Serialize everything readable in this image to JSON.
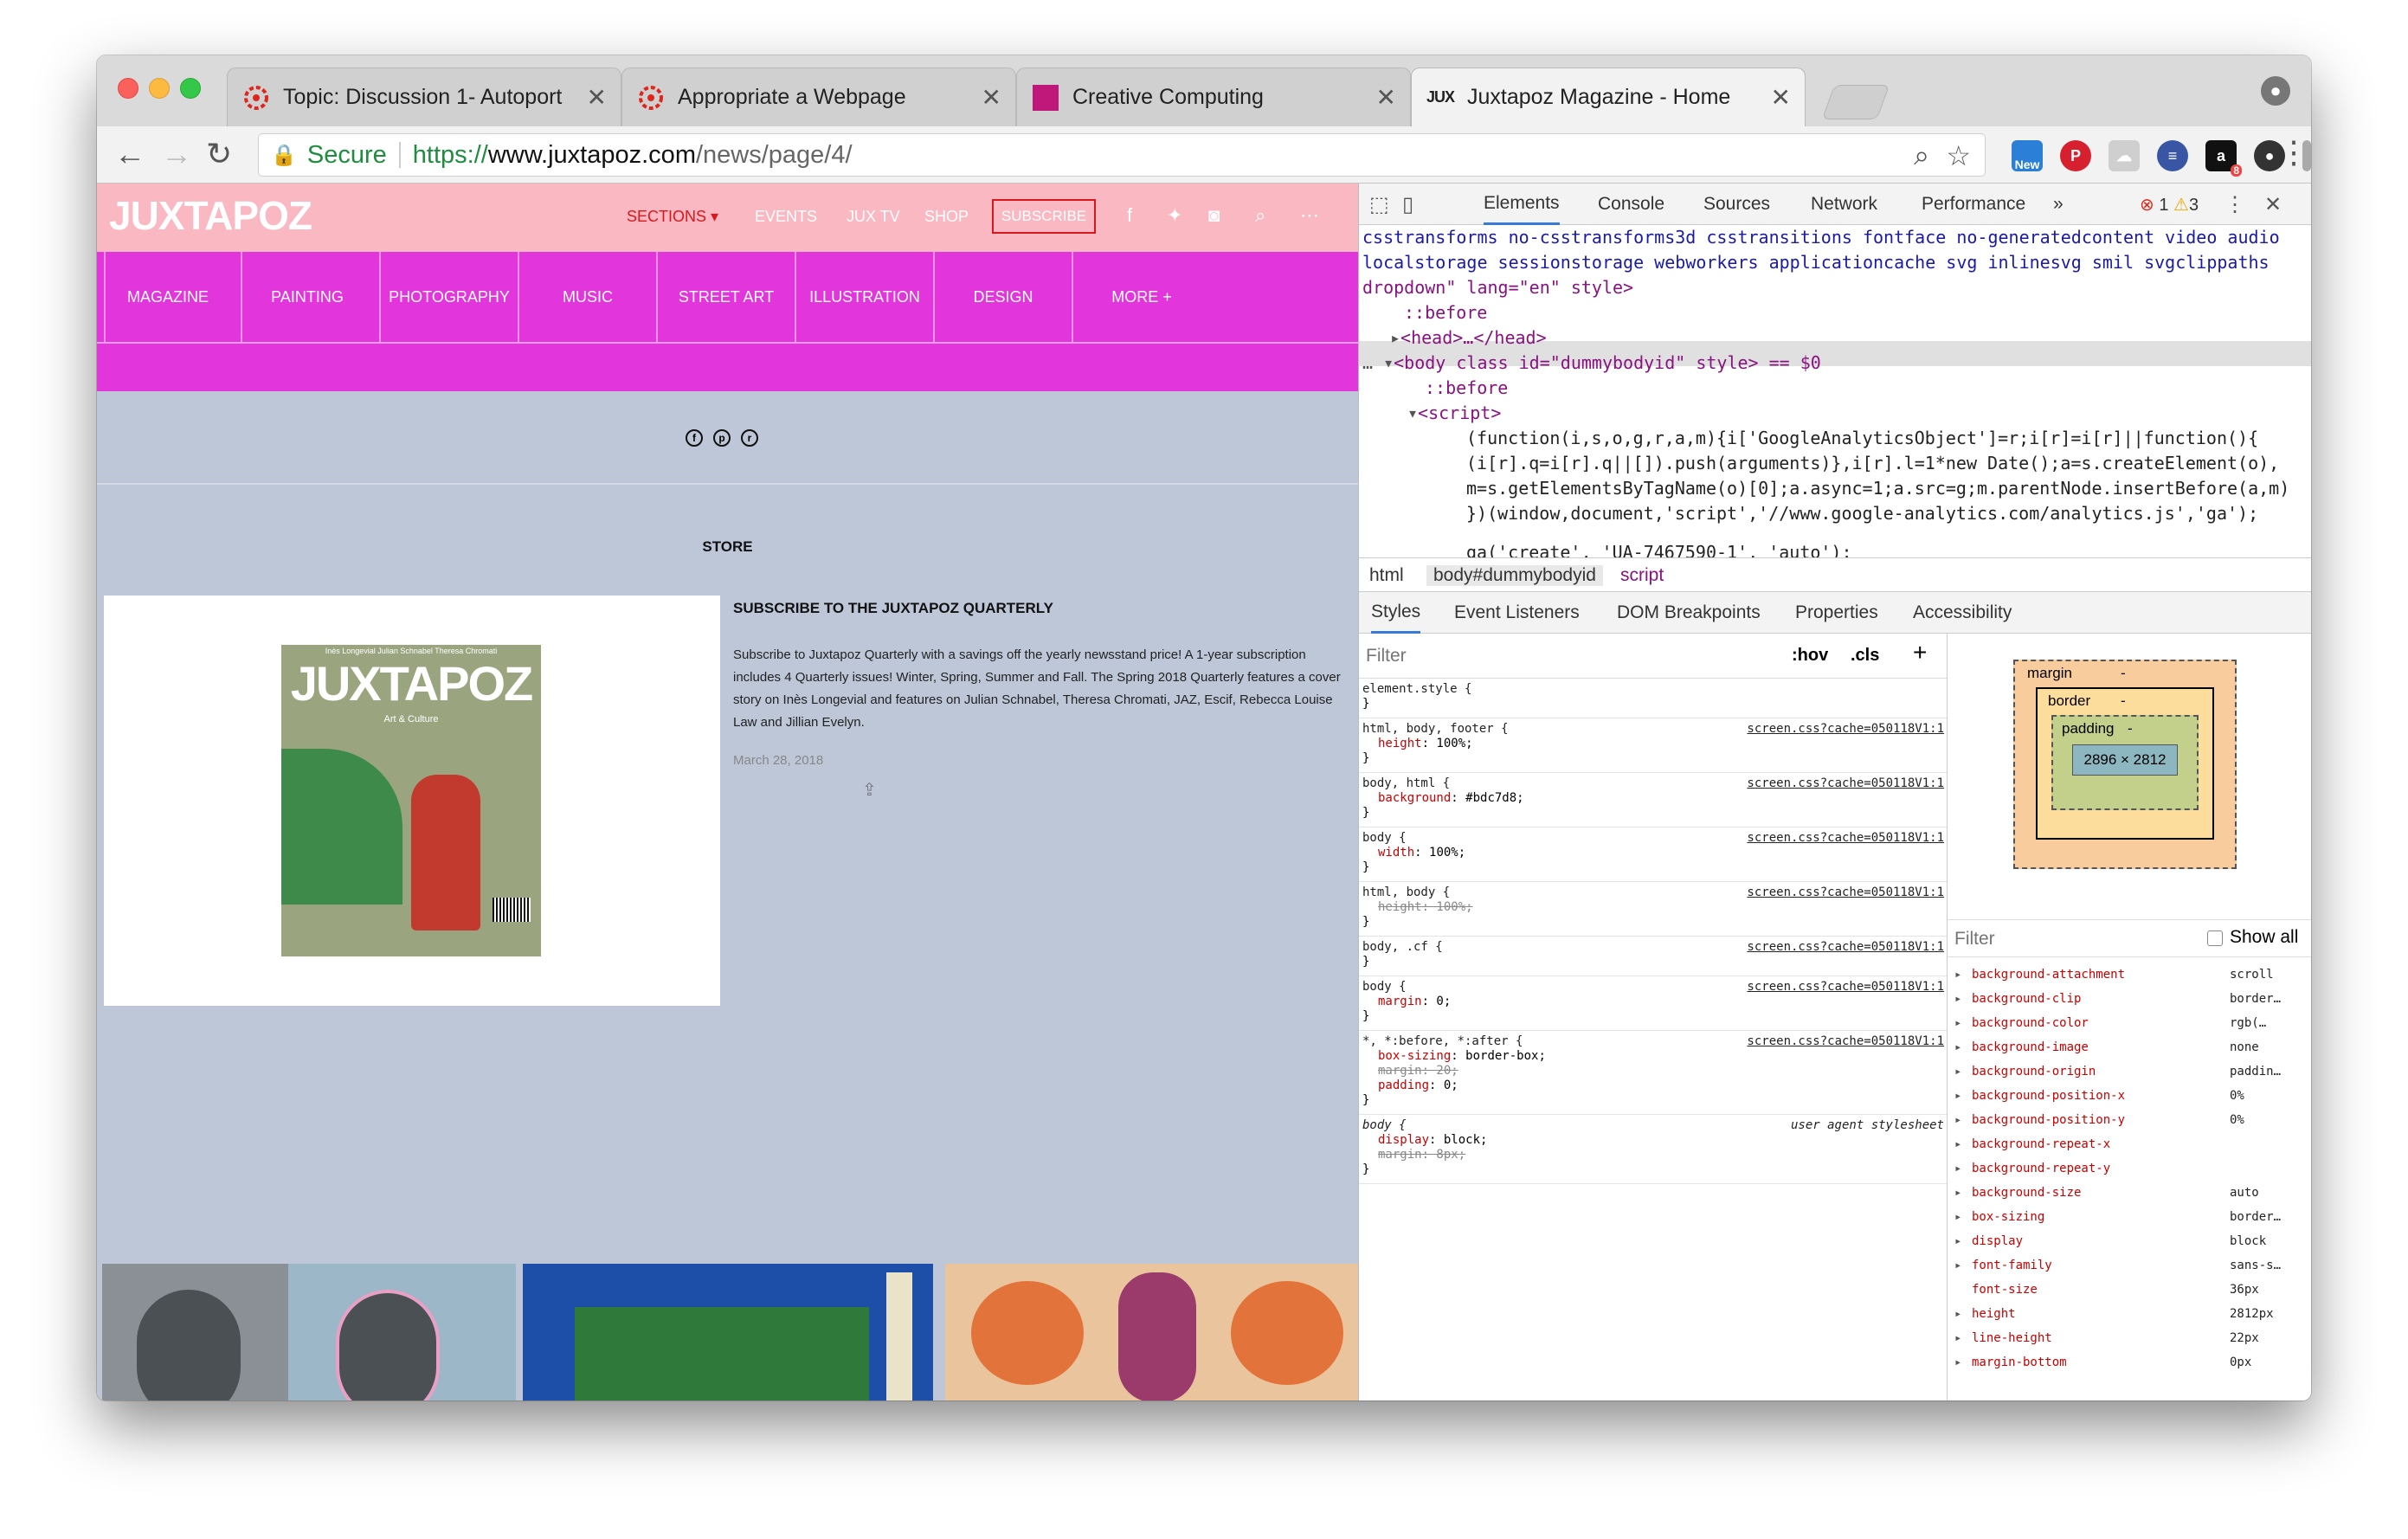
{
  "tabs": [
    {
      "title": "Topic: Discussion 1- Autoport",
      "close": "✕"
    },
    {
      "title": "Appropriate a Webpage",
      "close": "✕"
    },
    {
      "title": "Creative Computing",
      "close": "✕"
    },
    {
      "title": "Juxtapoz Magazine - Home",
      "close": "✕",
      "favicon_text": "JUX"
    }
  ],
  "toolbar": {
    "secure_label": "Secure",
    "url_scheme": "https://",
    "url_host": "www.juxtapoz.com",
    "url_path": "/news/page/4/",
    "ext_new_label": "New",
    "ext_badge": "8"
  },
  "site": {
    "logo": "JUXTAPOZ",
    "nav": {
      "sections": "SECTIONS",
      "events": "EVENTS",
      "juxtv": "JUX TV",
      "shop": "SHOP",
      "subscribe": "SUBSCRIBE"
    },
    "categories": [
      "MAGAZINE",
      "PAINTING",
      "PHOTOGRAPHY",
      "MUSIC",
      "STREET ART",
      "ILLUSTRATION",
      "DESIGN",
      "MORE +"
    ],
    "store_heading": "STORE",
    "article": {
      "title": "SUBSCRIBE TO THE JUXTAPOZ QUARTERLY",
      "body": "Subscribe to Juxtapoz Quarterly with a savings off the yearly newsstand price! A 1-year subscription includes 4 Quarterly issues! Winter, Spring, Summer and Fall. The Spring 2018 Quarterly features a cover story on Inès Longevial and features on Julian Schnabel, Theresa Chromati, JAZ, Escif, Rebecca Louise Law and Jillian Evelyn.",
      "date": "March 28, 2018"
    },
    "cover": {
      "top_line": "Inès Longevial  Julian Schnabel  Theresa Chromati",
      "logo": "JUXTAPOZ",
      "sub": "Art & Culture"
    }
  },
  "devtools": {
    "tabs": [
      "Elements",
      "Console",
      "Sources",
      "Network",
      "Performance",
      "»"
    ],
    "errors": "1",
    "warnings": "3",
    "dom_lines": [
      "csstransforms no-csstransforms3d csstransitions fontface no-generatedcontent video audio",
      "localstorage sessionstorage webworkers applicationcache svg inlinesvg smil svgclippaths",
      "dropdown\" lang=\"en\" style>",
      "::before",
      "<head>…</head>",
      "<body class id=\"dummybodyid\" style> == $0",
      "::before",
      "<script>",
      "(function(i,s,o,g,r,a,m){i['GoogleAnalyticsObject']=r;i[r]=i[r]||function(){",
      "(i[r].q=i[r].q||[]).push(arguments)},i[r].l=1*new Date();a=s.createElement(o),",
      "m=s.getElementsByTagName(o)[0];a.async=1;a.src=g;m.parentNode.insertBefore(a,m)",
      "})(window,document,'script','//www.google-analytics.com/analytics.js','ga');",
      "",
      "ga('create', 'UA-7467590-1', 'auto');"
    ],
    "breadcrumbs": [
      "html",
      "body#dummybodyid",
      "script"
    ],
    "subtabs": [
      "Styles",
      "Event Listeners",
      "DOM Breakpoints",
      "Properties",
      "Accessibility"
    ],
    "styles_filter_placeholder": "Filter",
    "hov": ":hov",
    "cls": ".cls",
    "plus": "+",
    "rules": [
      {
        "selector": "element.style {",
        "source": "",
        "props": [],
        "close": "}"
      },
      {
        "selector": "html, body, footer {",
        "source": "screen.css?cache=050118V1:1",
        "props": [
          {
            "name": "height",
            "value": "100%;",
            "struck": false
          }
        ],
        "close": "}"
      },
      {
        "selector": "body, html {",
        "source": "screen.css?cache=050118V1:1",
        "props": [
          {
            "name": "background",
            "value": "#bdc7d8;",
            "struck": false
          }
        ],
        "close": "}"
      },
      {
        "selector": "body {",
        "source": "screen.css?cache=050118V1:1",
        "props": [
          {
            "name": "width",
            "value": "100%;",
            "struck": false
          }
        ],
        "close": "}"
      },
      {
        "selector": "html, body {",
        "source": "screen.css?cache=050118V1:1",
        "props": [
          {
            "name": "height",
            "value": "100%;",
            "struck": true
          }
        ],
        "close": "}"
      },
      {
        "selector": "body, .cf {",
        "source": "screen.css?cache=050118V1:1",
        "props": [],
        "close": "}"
      },
      {
        "selector": "body {",
        "source": "screen.css?cache=050118V1:1",
        "props": [
          {
            "name": "margin",
            "value": "0;",
            "struck": false
          }
        ],
        "close": "}"
      },
      {
        "selector": "*, *:before, *:after {",
        "source": "screen.css?cache=050118V1:1",
        "props": [
          {
            "name": "box-sizing",
            "value": "border-box;",
            "struck": false
          },
          {
            "name": "margin",
            "value": "20;",
            "struck": true
          },
          {
            "name": "padding",
            "value": "0;",
            "struck": false
          }
        ],
        "close": "}"
      },
      {
        "selector": "body {",
        "source": "user agent stylesheet",
        "props": [
          {
            "name": "display",
            "value": "block;",
            "struck": false
          },
          {
            "name": "margin",
            "value": "8px;",
            "struck": true
          }
        ],
        "close": "}"
      }
    ],
    "boxmodel": {
      "margin": "margin",
      "border": "border",
      "padding": "padding",
      "content": "2896 × 2812",
      "dash": "-"
    },
    "computed_filter": "Filter",
    "show_all": "Show all",
    "computed": [
      {
        "name": "background-attachment",
        "value": "scroll"
      },
      {
        "name": "background-clip",
        "value": "border…"
      },
      {
        "name": "background-color",
        "value": "rgb(…"
      },
      {
        "name": "background-image",
        "value": "none"
      },
      {
        "name": "background-origin",
        "value": "paddin…"
      },
      {
        "name": "background-position-x",
        "value": "0%"
      },
      {
        "name": "background-position-y",
        "value": "0%"
      },
      {
        "name": "background-repeat-x",
        "value": ""
      },
      {
        "name": "background-repeat-y",
        "value": ""
      },
      {
        "name": "background-size",
        "value": "auto"
      },
      {
        "name": "box-sizing",
        "value": "border…"
      },
      {
        "name": "display",
        "value": "block"
      },
      {
        "name": "font-family",
        "value": "sans-s…"
      },
      {
        "name": "font-size",
        "value": "36px"
      },
      {
        "name": "height",
        "value": "2812px"
      },
      {
        "name": "line-height",
        "value": "22px"
      },
      {
        "name": "margin-bottom",
        "value": "0px"
      }
    ]
  },
  "colors": {
    "page_bg": "#bdc7d8",
    "header_pink": "#f9b8c2",
    "nav_magenta": "#e236dc",
    "accent_red": "#d9181b"
  }
}
